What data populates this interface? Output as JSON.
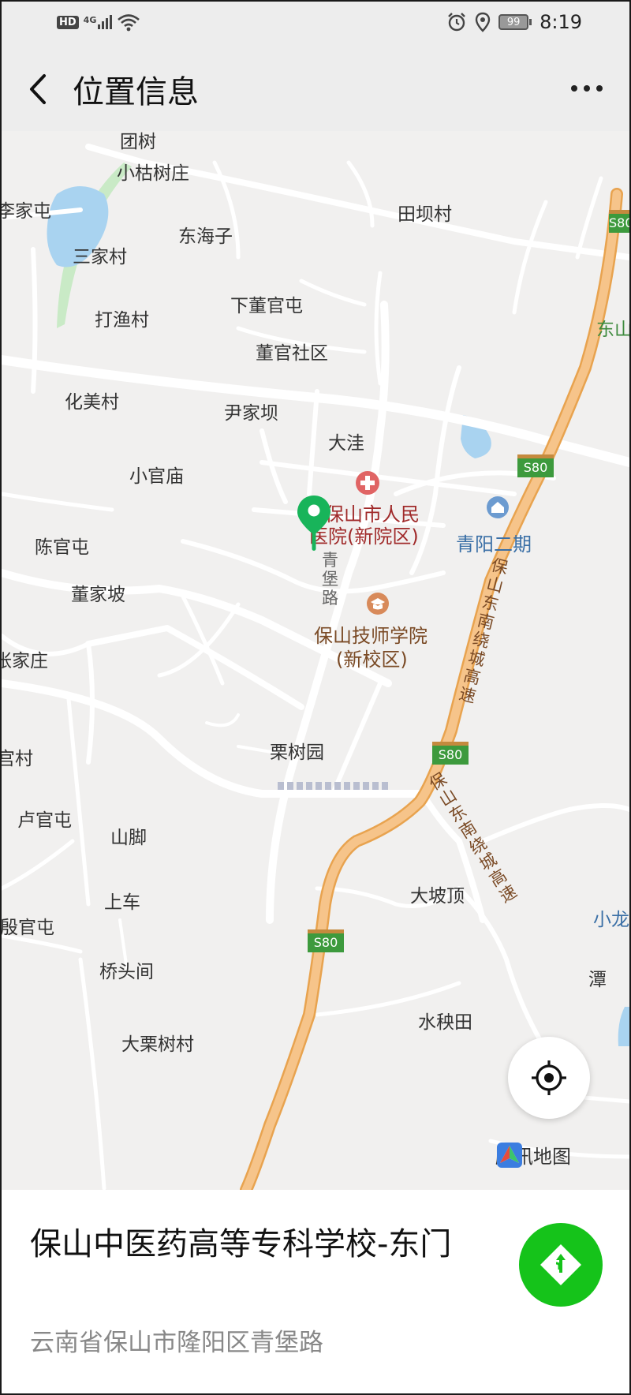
{
  "status_bar": {
    "hd_label": "HD",
    "network_label": "4G",
    "battery_level": "99",
    "time": "8:19"
  },
  "header": {
    "title": "位置信息"
  },
  "map": {
    "labels": {
      "tuanshu": "团树",
      "xiaoqiaoshuzhuang": "小枯树庄",
      "lijiatun": "李家屯",
      "tianbacun": "田坝村",
      "donghaizi": "东海子",
      "sanjiacun": "三家村",
      "xiadongguantun": "下董官屯",
      "dayucun": "打渔村",
      "dongshan": "东山",
      "dongguanshequ": "董官社区",
      "huameicun": "化美村",
      "yinjiaba": "尹家坝",
      "dawa": "大洼",
      "xiaoguanmiao": "小官庙",
      "hospital_line1": "保山市人民",
      "hospital_line2": "医院(新院区)",
      "qingyang": "青阳二期",
      "chenguantun": "陈官屯",
      "dongjiapo": "董家坡",
      "qingbaolu": "青堡路",
      "technician_line1": "保山技师学院",
      "technician_line2": "(新校区)",
      "zhangjiazhuang": "张家庄",
      "highway_name": "保山东南绕城高速",
      "gongcun": "宫村",
      "lishuyuan": "栗树园",
      "luguantun": "卢官屯",
      "shanjiao": "山脚",
      "dapoding": "大坡顶",
      "shangche": "上车",
      "yinguantun": "殷官屯",
      "xiaolong": "小龙",
      "qiaotoujian": "桥头间",
      "tan": "潭",
      "shuiyangtian": "水秧田",
      "dalishuzhuang": "大栗树村"
    },
    "highway_shield": "S80",
    "brand": "腾讯地图"
  },
  "place": {
    "name": "保山中医药高等专科学校-东门",
    "address": "云南省保山市隆阳区青堡路"
  },
  "colors": {
    "accent_green": "#15c31a",
    "pin_green": "#18b45a",
    "highway_orange": "#f6b86e",
    "highway_shield_green": "#3d9a3d"
  }
}
